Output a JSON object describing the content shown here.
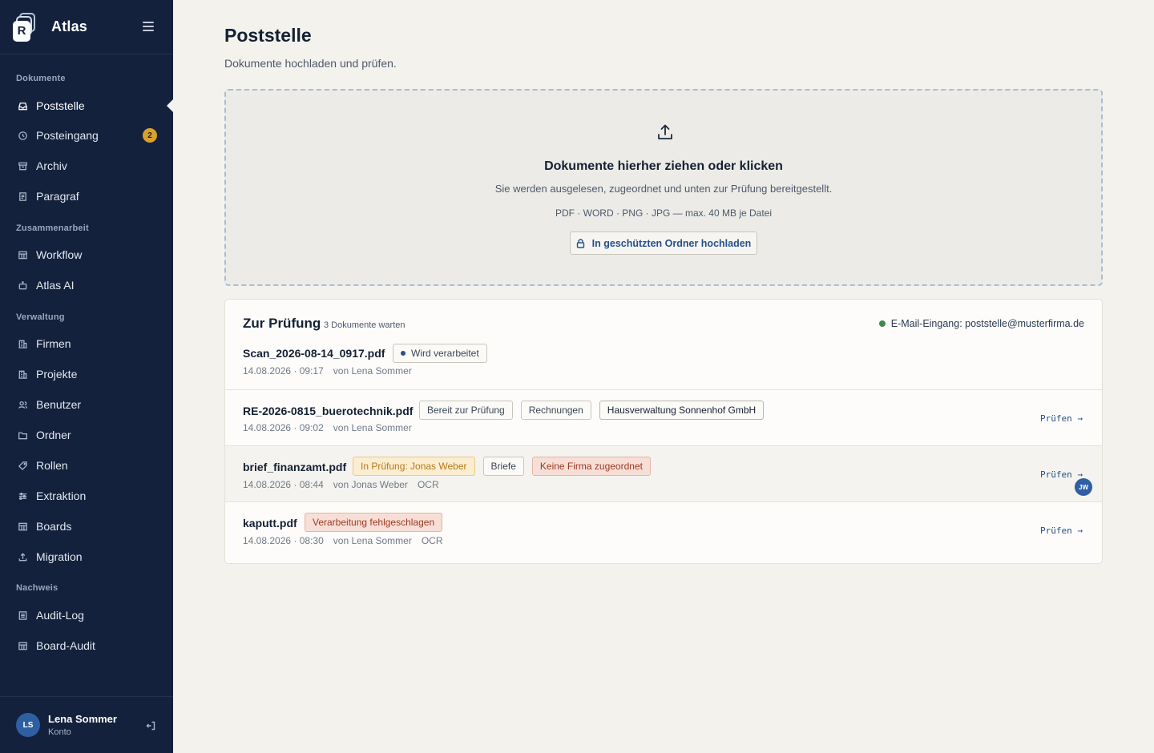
{
  "app": {
    "name": "Atlas",
    "logo_letter": "R"
  },
  "sidebar": {
    "sections": {
      "dokumente": "Dokumente",
      "zusammenarbeit": "Zusammenarbeit",
      "verwaltung": "Verwaltung",
      "nachweis": "Nachweis"
    },
    "items": [
      {
        "label": "Poststelle",
        "icon": "inbox-tray-icon",
        "active": true
      },
      {
        "label": "Posteingang",
        "icon": "clock-icon",
        "badge": "2"
      },
      {
        "label": "Archiv",
        "icon": "archive-box-icon"
      },
      {
        "label": "Paragraf",
        "icon": "document-icon"
      },
      {
        "label": "Workflow",
        "icon": "table-icon"
      },
      {
        "label": "Atlas AI",
        "icon": "robot-icon"
      },
      {
        "label": "Firmen",
        "icon": "building-icon"
      },
      {
        "label": "Projekte",
        "icon": "building-icon"
      },
      {
        "label": "Benutzer",
        "icon": "users-icon"
      },
      {
        "label": "Ordner",
        "icon": "folder-icon"
      },
      {
        "label": "Rollen",
        "icon": "tag-icon"
      },
      {
        "label": "Extraktion",
        "icon": "sliders-icon"
      },
      {
        "label": "Boards",
        "icon": "table-icon"
      },
      {
        "label": "Migration",
        "icon": "upload-icon"
      },
      {
        "label": "Audit-Log",
        "icon": "list-icon"
      },
      {
        "label": "Board-Audit",
        "icon": "table-icon"
      }
    ],
    "user": {
      "initials": "LS",
      "name": "Lena Sommer",
      "role": "Konto"
    }
  },
  "page": {
    "title": "Poststelle",
    "subtitle": "Dokumente hochladen und prüfen."
  },
  "dropzone": {
    "title": "Dokumente hierher ziehen oder klicken",
    "subtitle": "Sie werden ausgelesen, zugeordnet und unten zur Prüfung bereitgestellt.",
    "formats": "PDF · WORD · PNG · JPG — max. 40 MB je Datei",
    "secure_button": "In geschützten Ordner hochladen"
  },
  "review": {
    "title": "Zur Prüfung",
    "count": "3 Dokumente warten",
    "mail": "E-Mail-Eingang: poststelle@musterfirma.de",
    "action_label": "Prüfen →",
    "rows": [
      {
        "name": "Scan_2026-08-14_0917.pdf",
        "date": "14.08.2026 · 09:17",
        "by": "von Lena Sommer",
        "tags": [
          "Wird verarbeitet"
        ]
      },
      {
        "name": "RE-2026-0815_buerotechnik.pdf",
        "date": "14.08.2026 · 09:02",
        "by": "von Lena Sommer",
        "tags": [
          "Bereit zur Prüfung",
          "Rechnungen",
          "Hausverwaltung Sonnenhof GmbH"
        ]
      },
      {
        "name": "brief_finanzamt.pdf",
        "date": "14.08.2026 · 08:44",
        "by": "von Jonas Weber",
        "extra": "OCR",
        "tags": [
          "In Prüfung: Jonas Weber",
          "Briefe",
          "Keine Firma zugeordnet"
        ],
        "assignee_initials": "JW"
      },
      {
        "name": "kaputt.pdf",
        "date": "14.08.2026 · 08:30",
        "by": "von Lena Sommer",
        "extra": "OCR",
        "tags": [
          "Verarbeitung fehlgeschlagen"
        ]
      }
    ]
  },
  "colors": {
    "sidebar_bg": "#14213d",
    "page_bg": "#f4f2ed",
    "accent": "#27508a",
    "badge": "#d9a12a",
    "success": "#3e8a4d",
    "warn": "#b8791c",
    "error": "#9e3a22"
  }
}
